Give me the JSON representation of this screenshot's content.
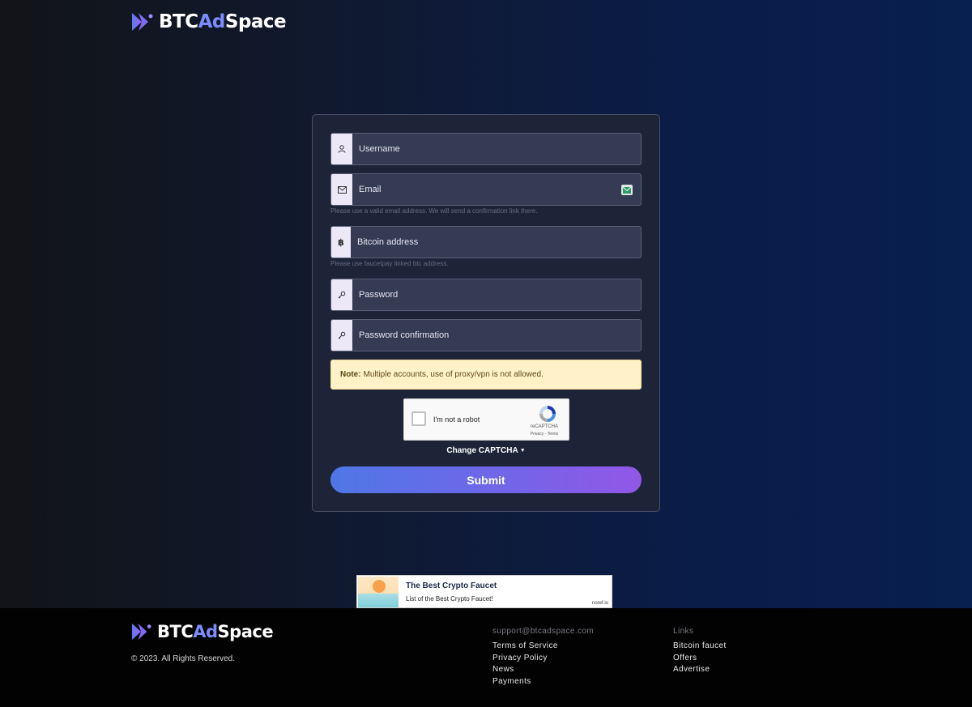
{
  "brand": {
    "name_part1": "BTC",
    "name_part2": "Ad",
    "name_part3": "Space",
    "accent_color": "#7c8cff"
  },
  "form": {
    "username_placeholder": "Username",
    "email_placeholder": "Email",
    "email_hint": "Please use a valid email address. We will send a confirmation link there.",
    "btc_placeholder": "Bitcoin address",
    "btc_hint": "Please use faucetpay linked btc address.",
    "password_placeholder": "Password",
    "password_confirm_placeholder": "Password confirmation",
    "btc_icon": "฿",
    "note_label": "Note:",
    "note_text": "Multiple accounts, use of proxy/vpn is not allowed.",
    "change_captcha": "Change CAPTCHA",
    "submit_label": "Submit",
    "icons": {
      "username": "user-icon",
      "email": "envelope-icon",
      "btc": "bitcoin-icon",
      "password": "key-icon"
    }
  },
  "captcha": {
    "label": "I'm not a robot",
    "brand": "reCAPTCHA",
    "privacy": "Privacy",
    "separator": " - ",
    "terms": "Terms"
  },
  "ad": {
    "title": "The Best Crypto Faucet",
    "subtitle": "List of the Best Crypto Faucet!",
    "brand": "noref.io"
  },
  "footer": {
    "copyright": "© 2023. All Rights Reserved.",
    "support_email": "support@btcadspace.com",
    "col1_links": [
      "Terms of Service",
      "Privacy Policy",
      "News",
      "Payments"
    ],
    "links_heading": "Links",
    "col2_links": [
      "Bitcoin faucet",
      "Offers",
      "Advertise"
    ]
  }
}
